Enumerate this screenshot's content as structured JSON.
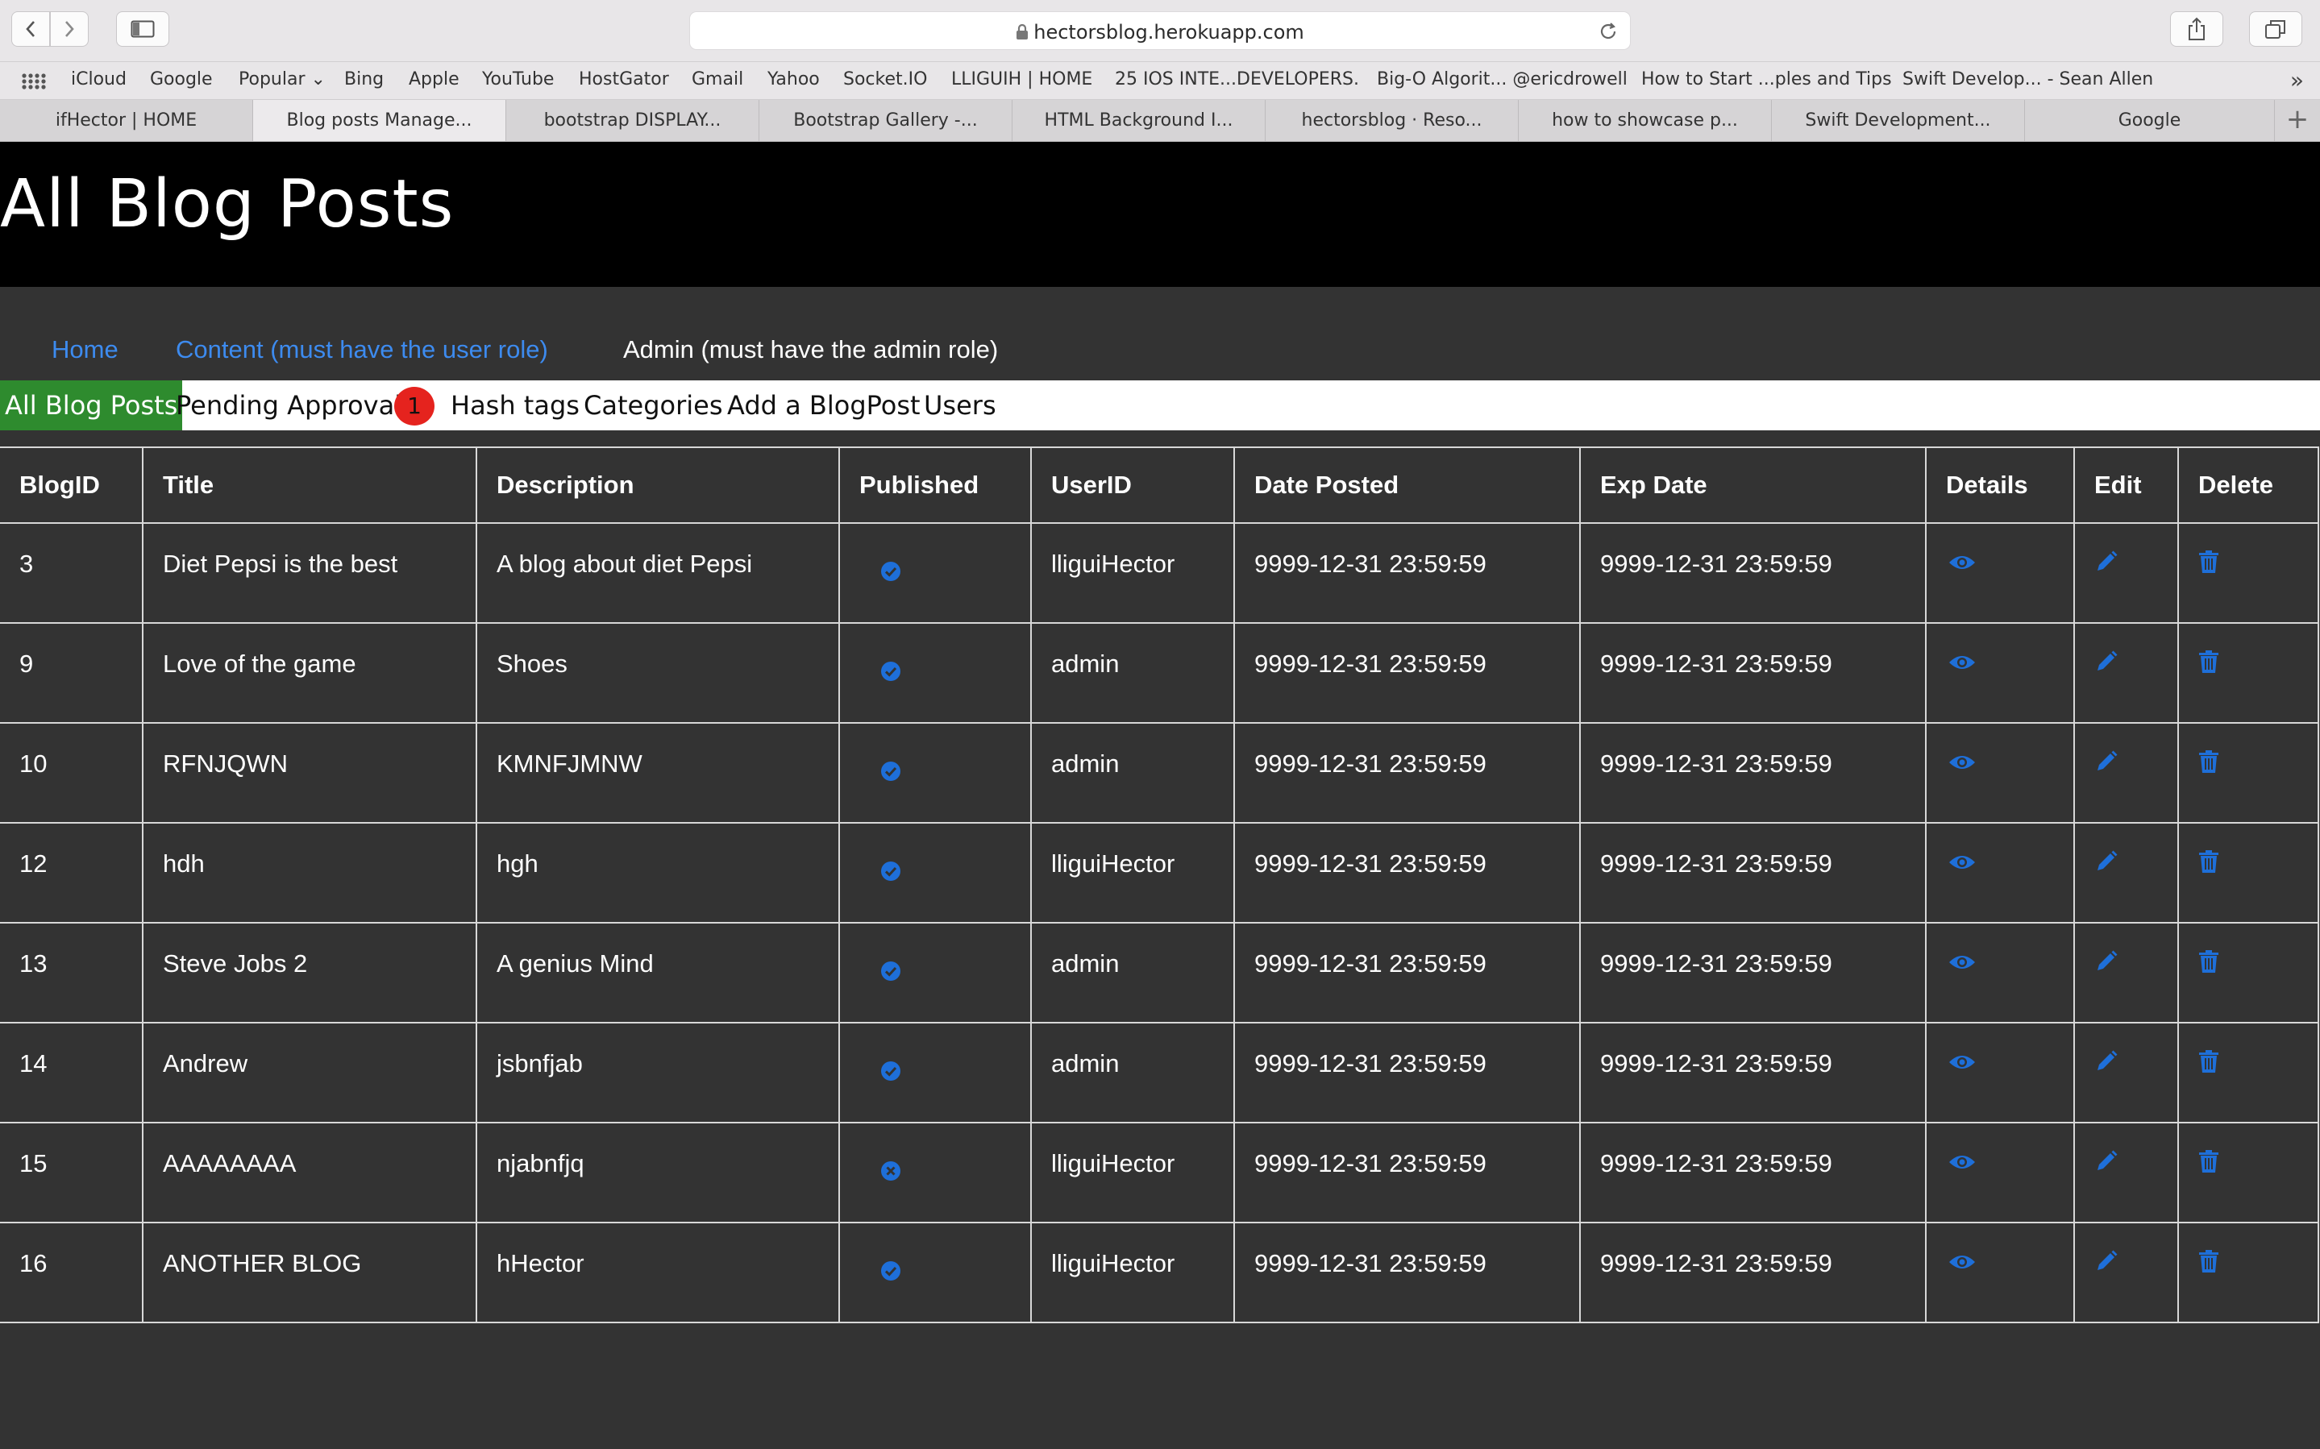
{
  "browser": {
    "url": "hectorsblog.herokuapp.com",
    "bookmarks": [
      {
        "label": "iCloud"
      },
      {
        "label": "Google"
      },
      {
        "label": "Popular ⌄"
      },
      {
        "label": "Bing"
      },
      {
        "label": "Apple"
      },
      {
        "label": "YouTube"
      },
      {
        "label": "HostGator"
      },
      {
        "label": "Gmail"
      },
      {
        "label": "Yahoo"
      },
      {
        "label": "Socket.IO"
      },
      {
        "label": "LLIGUIH | HOME"
      },
      {
        "label": "25 IOS INTE...DEVELOPERS."
      },
      {
        "label": "Big-O Algorit... @ericdrowell"
      },
      {
        "label": "How to Start ...ples and Tips"
      },
      {
        "label": "Swift Develop... - Sean Allen"
      }
    ],
    "bookmarks_more": "»",
    "tabs": [
      {
        "label": "ifHector | HOME"
      },
      {
        "label": "Blog posts Manage..."
      },
      {
        "label": "bootstrap DISPLAY..."
      },
      {
        "label": "Bootstrap Gallery -..."
      },
      {
        "label": "HTML Background I..."
      },
      {
        "label": "hectorsblog · Reso..."
      },
      {
        "label": "how to showcase p..."
      },
      {
        "label": "Swift Development..."
      },
      {
        "label": "Google"
      }
    ],
    "active_tab": 1,
    "tab_add": "+"
  },
  "page": {
    "title": "All Blog Posts",
    "main_nav": [
      {
        "label": "Home",
        "color": "#3d8bef"
      },
      {
        "label": "Content (must have the user role)",
        "color": "#3d8bef"
      },
      {
        "label": "Admin (must have the admin role)",
        "color": "#ffffff"
      }
    ],
    "subnav": [
      {
        "label": "All Blog Posts",
        "active": true
      },
      {
        "label": "Pending Approval",
        "badge": "1"
      },
      {
        "label": "Hash tags"
      },
      {
        "label": "Categories"
      },
      {
        "label": "Add a BlogPost"
      },
      {
        "label": "Users"
      }
    ],
    "colors": {
      "header_bg": "#000000",
      "body_bg": "#333333",
      "link_blue": "#3d8bef",
      "icon_blue": "#1e6fd9",
      "active_green": "#2e8b2e",
      "badge_red": "#e5231e"
    }
  },
  "table": {
    "columns": [
      "BlogID",
      "Title",
      "Description",
      "Published",
      "UserID",
      "Date Posted",
      "Exp Date",
      "Details",
      "Edit",
      "Delete"
    ],
    "rows": [
      {
        "id": "3",
        "title": "Diet Pepsi is the best",
        "description": "A blog about diet Pepsi",
        "published": true,
        "user": "lliguiHector",
        "posted": "9999-12-31 23:59:59",
        "exp": "9999-12-31 23:59:59"
      },
      {
        "id": "9",
        "title": "Love of the game",
        "description": "Shoes",
        "published": true,
        "user": "admin",
        "posted": "9999-12-31 23:59:59",
        "exp": "9999-12-31 23:59:59"
      },
      {
        "id": "10",
        "title": "RFNJQWN",
        "description": "KMNFJMNW",
        "published": true,
        "user": "admin",
        "posted": "9999-12-31 23:59:59",
        "exp": "9999-12-31 23:59:59"
      },
      {
        "id": "12",
        "title": "hdh",
        "description": "hgh",
        "published": true,
        "user": "lliguiHector",
        "posted": "9999-12-31 23:59:59",
        "exp": "9999-12-31 23:59:59"
      },
      {
        "id": "13",
        "title": "Steve Jobs 2",
        "description": "A genius Mind",
        "published": true,
        "user": "admin",
        "posted": "9999-12-31 23:59:59",
        "exp": "9999-12-31 23:59:59"
      },
      {
        "id": "14",
        "title": "Andrew",
        "description": "jsbnfjab",
        "published": true,
        "user": "admin",
        "posted": "9999-12-31 23:59:59",
        "exp": "9999-12-31 23:59:59"
      },
      {
        "id": "15",
        "title": "AAAAAAAA",
        "description": "njabnfjq",
        "published": false,
        "user": "lliguiHector",
        "posted": "9999-12-31 23:59:59",
        "exp": "9999-12-31 23:59:59"
      },
      {
        "id": "16",
        "title": "ANOTHER BLOG",
        "description": "hHector",
        "published": true,
        "user": "lliguiHector",
        "posted": "9999-12-31 23:59:59",
        "exp": "9999-12-31 23:59:59"
      }
    ],
    "icons": {
      "published_true": "check-circle-icon",
      "published_false": "x-circle-icon",
      "details": "eye-icon",
      "edit": "pencil-icon",
      "delete": "trash-icon"
    }
  }
}
